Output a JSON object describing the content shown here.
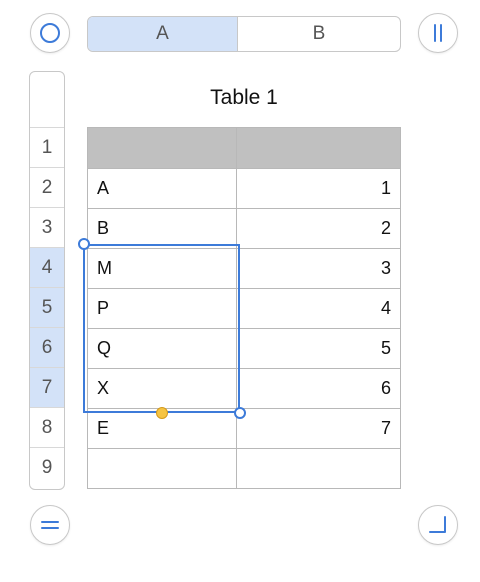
{
  "table": {
    "title": "Table 1",
    "columns": [
      {
        "label": "A",
        "selected": true
      },
      {
        "label": "B",
        "selected": false
      }
    ],
    "row_numbers": [
      "1",
      "2",
      "3",
      "4",
      "5",
      "6",
      "7",
      "8",
      "9"
    ],
    "selected_rows": [
      "4",
      "5",
      "6",
      "7"
    ],
    "rows": [
      {
        "a": "",
        "b": ""
      },
      {
        "a": "A",
        "b": "1"
      },
      {
        "a": "B",
        "b": "2"
      },
      {
        "a": "M",
        "b": "3"
      },
      {
        "a": "P",
        "b": "4"
      },
      {
        "a": "Q",
        "b": "5"
      },
      {
        "a": "X",
        "b": "6"
      },
      {
        "a": "E",
        "b": "7"
      },
      {
        "a": "",
        "b": ""
      }
    ]
  },
  "controls": {
    "top_left_icon": "circle-select-icon",
    "top_right_icon": "pause-columns-icon",
    "bottom_left_icon": "equals-rows-icon",
    "bottom_right_icon": "resize-corner-icon"
  },
  "colors": {
    "accent": "#3d7bd9",
    "selection_highlight": "#d3e2f8",
    "header_fill": "#c0c0c0",
    "fill_handle": "#f6c443"
  }
}
